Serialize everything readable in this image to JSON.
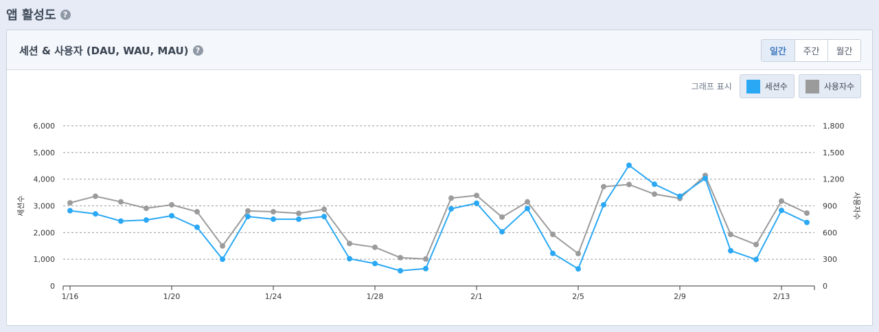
{
  "page": {
    "title": "앱 활성도",
    "help": "?"
  },
  "panel": {
    "title": "세션 & 사용자 (DAU, WAU, MAU)",
    "help": "?",
    "tabs": [
      "일간",
      "주간",
      "월간"
    ],
    "active_tab": 0,
    "legend_caption": "그래프 표시",
    "legend": [
      {
        "label": "세션수",
        "color": "#2aa8f4"
      },
      {
        "label": "사용자수",
        "color": "#9b9b9b"
      }
    ]
  },
  "chart_data": {
    "type": "line",
    "x_tick_labels": [
      "1/16",
      "1/20",
      "1/24",
      "1/28",
      "2/1",
      "2/5",
      "2/9",
      "2/13"
    ],
    "ylabel_left": "세션수",
    "ylabel_right": "사용자수",
    "ylim_left": [
      0,
      6000
    ],
    "ylim_right": [
      0,
      1800
    ],
    "yticks_left": [
      "0",
      "1,000",
      "2,000",
      "3,000",
      "4,000",
      "5,000",
      "6,000"
    ],
    "yticks_right": [
      "0",
      "300",
      "600",
      "900",
      "1,200",
      "1,500",
      "1,800"
    ],
    "grid": true,
    "series": [
      {
        "name": "세션수",
        "axis": "left",
        "color": "#2aa8f4",
        "values": [
          2820,
          2700,
          2430,
          2470,
          2630,
          2200,
          1000,
          2600,
          2500,
          2500,
          2600,
          1020,
          840,
          570,
          650,
          2890,
          3100,
          2030,
          2900,
          1220,
          640,
          3040,
          4520,
          3810,
          3360,
          4030,
          1320,
          990,
          2830,
          2380
        ]
      },
      {
        "name": "사용자수",
        "axis": "right",
        "color": "#9b9b9b",
        "values": [
          934,
          1008,
          945,
          873,
          912,
          834,
          450,
          843,
          834,
          816,
          861,
          477,
          435,
          318,
          303,
          987,
          1017,
          774,
          945,
          579,
          363,
          1116,
          1140,
          1032,
          984,
          1242,
          579,
          465,
          954,
          819
        ]
      }
    ]
  }
}
